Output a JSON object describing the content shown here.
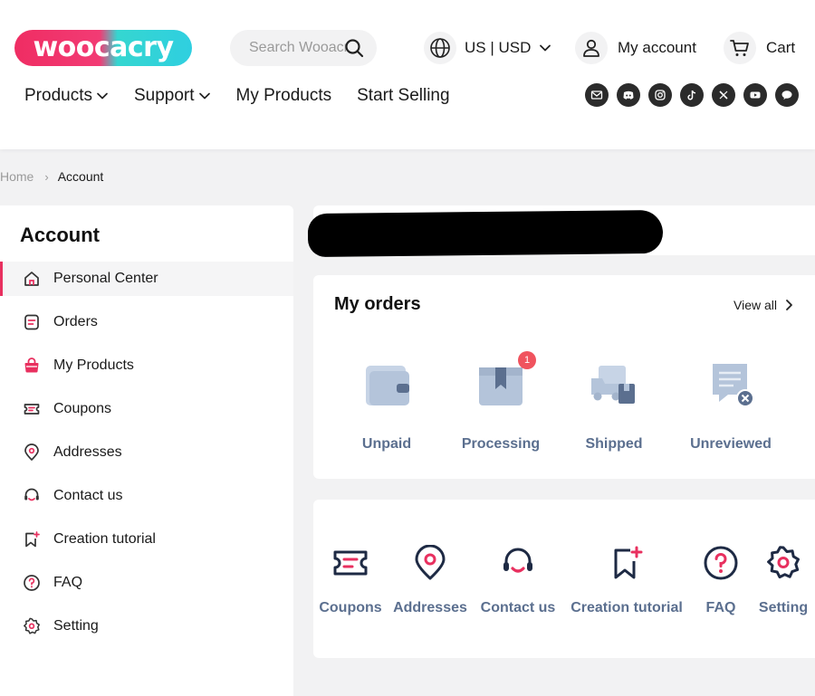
{
  "brand": {
    "logo_text": "woocacry",
    "accent": "#e8305f",
    "teal": "#2fcfe0"
  },
  "search": {
    "placeholder": "Search Wooacry",
    "icon": "search-icon"
  },
  "header": {
    "locale_label": "US | USD",
    "account_label": "My account",
    "cart_label": "Cart"
  },
  "nav": {
    "items": [
      {
        "label": "Products",
        "has_dropdown": true
      },
      {
        "label": "Support",
        "has_dropdown": true
      },
      {
        "label": "My Products",
        "has_dropdown": false
      },
      {
        "label": "Start Selling",
        "has_dropdown": false
      }
    ]
  },
  "socials": [
    "email-icon",
    "discord-icon",
    "instagram-icon",
    "tiktok-icon",
    "x-icon",
    "youtube-icon",
    "talk-icon"
  ],
  "breadcrumb": {
    "home": "Home",
    "separator": "›",
    "current": "Account"
  },
  "sidebar": {
    "title": "Account",
    "items": [
      {
        "label": "Personal Center",
        "icon": "home-icon",
        "active": true
      },
      {
        "label": "Orders",
        "icon": "orders-icon",
        "active": false
      },
      {
        "label": "My Products",
        "icon": "bag-icon",
        "active": false
      },
      {
        "label": "Coupons",
        "icon": "coupon-icon",
        "active": false
      },
      {
        "label": "Addresses",
        "icon": "location-pin-icon",
        "active": false
      },
      {
        "label": "Contact us",
        "icon": "headset-icon",
        "active": false
      },
      {
        "label": "Creation tutorial",
        "icon": "bookmark-plus-icon",
        "active": false
      },
      {
        "label": "FAQ",
        "icon": "question-icon",
        "active": false
      },
      {
        "label": "Setting",
        "icon": "settings-icon",
        "active": false
      }
    ]
  },
  "orders": {
    "title": "My orders",
    "view_all": "View all",
    "statuses": [
      {
        "label": "Unpaid",
        "icon": "wallet-icon",
        "count": null
      },
      {
        "label": "Processing",
        "icon": "box-icon",
        "count": "1"
      },
      {
        "label": "Shipped",
        "icon": "truck-icon",
        "count": null
      },
      {
        "label": "Unreviewed",
        "icon": "review-icon",
        "count": null
      }
    ]
  },
  "shortcuts": [
    {
      "label": "Coupons",
      "icon": "coupon-icon"
    },
    {
      "label": "Addresses",
      "icon": "location-pin-icon"
    },
    {
      "label": "Contact us",
      "icon": "headset-icon"
    },
    {
      "label": "Creation tutorial",
      "icon": "bookmark-plus-icon"
    },
    {
      "label": "FAQ",
      "icon": "question-icon"
    },
    {
      "label": "Setting",
      "icon": "settings-icon"
    }
  ]
}
